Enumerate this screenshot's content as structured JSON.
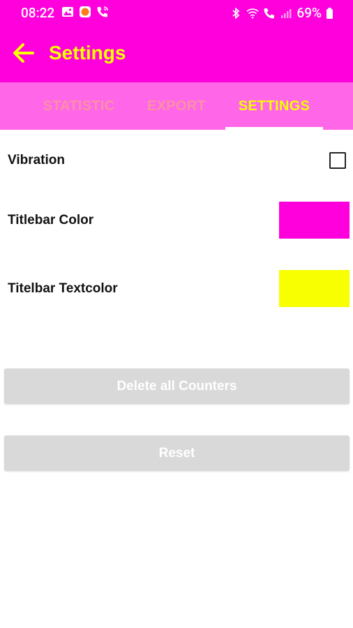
{
  "status_bar": {
    "time": "08:22",
    "battery_percent": "69%",
    "left_icons": [
      "gallery-icon",
      "app-notification-icon",
      "wifi-call-icon"
    ],
    "right_icons": [
      "bluetooth-icon",
      "wifi-icon",
      "wifi-call-signal-icon",
      "signal-icon",
      "battery-icon"
    ]
  },
  "app_bar": {
    "title": "Settings",
    "back_icon": "arrow-left-icon"
  },
  "tabs": [
    {
      "label": "STATISTIC",
      "active": false
    },
    {
      "label": "EXPORT",
      "active": false
    },
    {
      "label": "SETTINGS",
      "active": true
    }
  ],
  "settings": {
    "vibration": {
      "label": "Vibration",
      "checked": false
    },
    "titlebar_color": {
      "label": "Titlebar Color",
      "color": "#ff00dd"
    },
    "titlebar_textcolor": {
      "label": "Titelbar Textcolor",
      "color": "#f7ff00"
    }
  },
  "buttons": {
    "delete_all": "Delete all Counters",
    "reset": "Reset"
  },
  "colors": {
    "titlebar": "#ff00dd",
    "tabbar": "#ff66e8",
    "accent_text": "#f7ff00",
    "button_disabled": "#d9d9d9"
  }
}
